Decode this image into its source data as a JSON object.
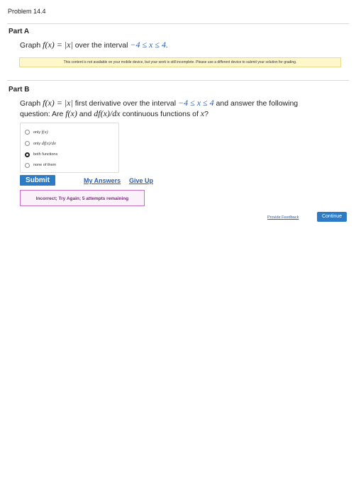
{
  "problem": {
    "title": "Problem 14.4"
  },
  "partA": {
    "heading": "Part A",
    "question_prefix": "Graph ",
    "func": "f(x) = |x|",
    "question_mid": " over the interval ",
    "interval": "−4 ≤ x ≤ 4.",
    "notice": "This content is not available on your mobile device, but your work is still incomplete. Please use a different device to submit your solution for grading."
  },
  "partB": {
    "heading": "Part B",
    "line1_prefix": "Graph ",
    "line1_func": "f(x) = |x|",
    "line1_mid": " first derivative over the interval ",
    "line1_interval": "−4 ≤ x ≤ 4",
    "line1_suffix": " and answer the following",
    "line2_prefix": "question: Are ",
    "line2_f": "f(x)",
    "line2_and": " and ",
    "line2_df": "df(x)/dx",
    "line2_mid": " continuous functions of ",
    "line2_x": "x",
    "line2_end": "?",
    "options": [
      {
        "prefix": "only ",
        "math": "f(x)",
        "selected": false
      },
      {
        "prefix": "only ",
        "math": "df(x)/dx",
        "selected": false
      },
      {
        "prefix": "both functions",
        "math": "",
        "selected": true
      },
      {
        "prefix": "none of them",
        "math": "",
        "selected": false
      }
    ]
  },
  "actions": {
    "submit": "Submit",
    "my_answers": "My Answers",
    "give_up": "Give Up"
  },
  "feedback": {
    "message": "Incorrect; Try Again; 5 attempts remaining"
  },
  "footer": {
    "provide_feedback": "Provide Feedback",
    "continue": "Continue"
  },
  "colors": {
    "accent": "#2d7bc4",
    "link": "#2a5db0",
    "error_border": "#c86ec8",
    "notice_bg": "#fff7c9"
  }
}
